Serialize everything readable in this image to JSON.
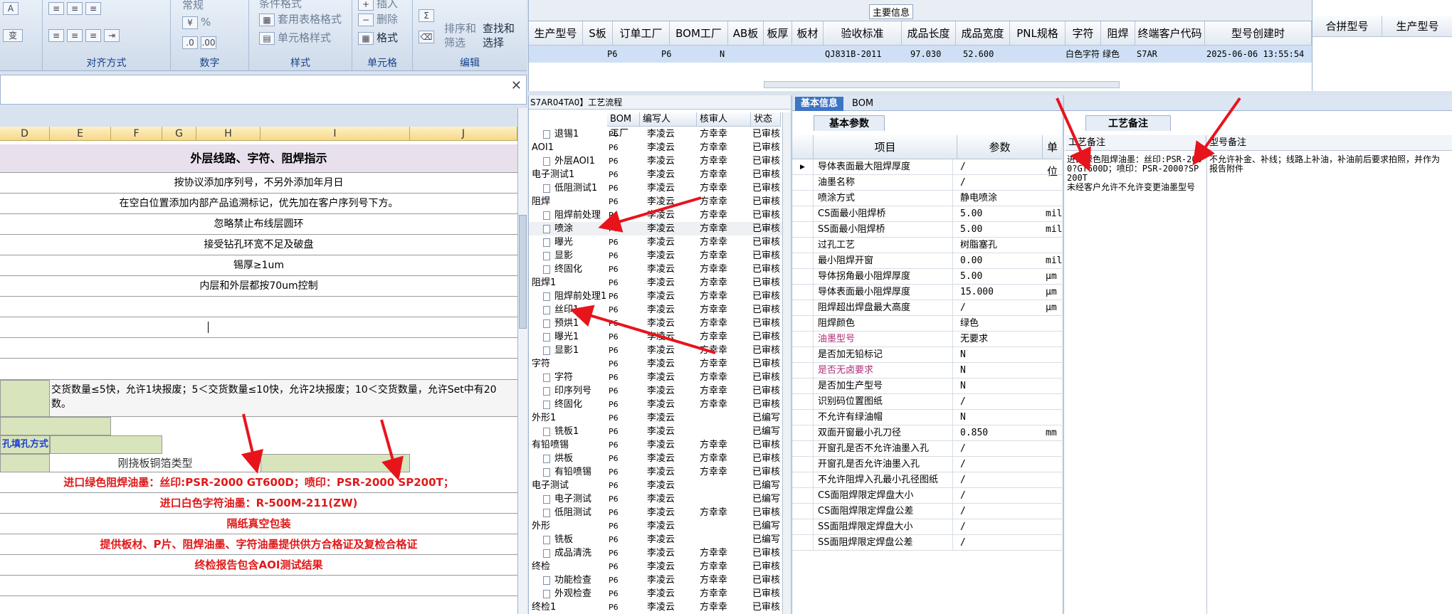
{
  "ribbon": {
    "groups": [
      {
        "label": "对齐方式"
      },
      {
        "label": "数字"
      },
      {
        "label": "样式"
      },
      {
        "label": "单元格"
      },
      {
        "label": "编辑"
      }
    ],
    "font_icons": {
      "a_up": "A",
      "a_down": "A",
      "change": "变"
    },
    "number_format": "常规",
    "percent": "%",
    "table_format": "套用表格格式",
    "cell_style": "单元格样式",
    "insert": "插入",
    "delete": "删除",
    "format": "格式",
    "sort_filter": "排序和\n筛选",
    "find_select": "查找和\n选择",
    "cond_format": "条件格式",
    "sum_icon": "Σ"
  },
  "sheet": {
    "columns": [
      "D",
      "E",
      "F",
      "G",
      "H",
      "I",
      "J"
    ],
    "title": "外层线路、字符、阻焊指示",
    "rows": [
      "按协议添加序列号，不另外添加年月日",
      "在空白位置添加内部产品追溯标记，优先加在客户序列号下方。",
      "忽略禁止布线层圆环",
      "接受钻孔环宽不足及破盘",
      "锡厚≥1um",
      "内层和外层都按70um控制"
    ],
    "delivery_note": "交货数量≤5快，允许1块报废；5＜交货数量≤10快，允许2块报废；10＜交货数量，允许Set中有20",
    "delivery_note2": "数。",
    "fill_method": "孔填孔方式",
    "copper_type": "刚挠板铜箔类型",
    "red_lines": [
      "进口绿色阻焊油墨：丝印:PSR-2000 GT600D；喷印：PSR-2000 SP200T；",
      "进口白色字符油墨：R-500M-211(ZW)",
      "隔纸真空包装",
      "提供板材、P片、阻焊油墨、字符油墨提供供方合格证及复检合格证",
      "终检报告包含AOI测试结果"
    ]
  },
  "main_grid": {
    "group_title": "主要信息",
    "headers": [
      "生产型号",
      "S板",
      "订单工厂",
      "BOM工厂",
      "AB板",
      "板厚",
      "板材",
      "验收标准",
      "成品长度",
      "成品宽度",
      "PNL规格",
      "字符",
      "阻焊",
      "终端客户代码",
      "型号创建时"
    ],
    "values": [
      "",
      "P6",
      "P6",
      "N",
      "",
      "",
      "",
      "QJ831B-2011",
      "97.030",
      "52.600",
      "",
      "白色字符",
      "绿色",
      "S7AR",
      "2025-06-06 13:55:54"
    ],
    "right_headers": [
      "合拼型号",
      "生产型号"
    ]
  },
  "tree": {
    "title": "S7AR04TA0】工艺流程",
    "headers": [
      "BOM工厂",
      "编写人",
      "核审人",
      "状态"
    ],
    "rows": [
      {
        "indent": 1,
        "name": "退锡1",
        "bom": "P6",
        "writer": "李凌云",
        "checker": "方幸幸",
        "status": "已审核"
      },
      {
        "indent": 0,
        "name": "AOI1",
        "bom": "P6",
        "writer": "李凌云",
        "checker": "方幸幸",
        "status": "已审核"
      },
      {
        "indent": 1,
        "name": "外层AOI1",
        "bom": "P6",
        "writer": "李凌云",
        "checker": "方幸幸",
        "status": "已审核"
      },
      {
        "indent": 0,
        "name": "电子测试1",
        "bom": "P6",
        "writer": "李凌云",
        "checker": "方幸幸",
        "status": "已审核"
      },
      {
        "indent": 1,
        "name": "低阻测试1",
        "bom": "P6",
        "writer": "李凌云",
        "checker": "方幸幸",
        "status": "已审核"
      },
      {
        "indent": 0,
        "name": "阻焊",
        "bom": "P6",
        "writer": "李凌云",
        "checker": "方幸幸",
        "status": "已审核"
      },
      {
        "indent": 1,
        "name": "阻焊前处理",
        "bom": "P6",
        "writer": "李凌云",
        "checker": "方幸幸",
        "status": "已审核"
      },
      {
        "indent": 1,
        "name": "喷涂",
        "bom": "P6",
        "writer": "李凌云",
        "checker": "方幸幸",
        "status": "已审核"
      },
      {
        "indent": 1,
        "name": "曝光",
        "bom": "P6",
        "writer": "李凌云",
        "checker": "方幸幸",
        "status": "已审核"
      },
      {
        "indent": 1,
        "name": "显影",
        "bom": "P6",
        "writer": "李凌云",
        "checker": "方幸幸",
        "status": "已审核"
      },
      {
        "indent": 1,
        "name": "终固化",
        "bom": "P6",
        "writer": "李凌云",
        "checker": "方幸幸",
        "status": "已审核"
      },
      {
        "indent": 0,
        "name": "阻焊1",
        "bom": "P6",
        "writer": "李凌云",
        "checker": "方幸幸",
        "status": "已审核"
      },
      {
        "indent": 1,
        "name": "阻焊前处理1",
        "bom": "P6",
        "writer": "李凌云",
        "checker": "方幸幸",
        "status": "已审核"
      },
      {
        "indent": 1,
        "name": "丝印1",
        "bom": "P6",
        "writer": "李凌云",
        "checker": "方幸幸",
        "status": "已审核"
      },
      {
        "indent": 1,
        "name": "预烘1",
        "bom": "P6",
        "writer": "李凌云",
        "checker": "方幸幸",
        "status": "已审核"
      },
      {
        "indent": 1,
        "name": "曝光1",
        "bom": "P6",
        "writer": "李凌云",
        "checker": "方幸幸",
        "status": "已审核"
      },
      {
        "indent": 1,
        "name": "显影1",
        "bom": "P6",
        "writer": "李凌云",
        "checker": "方幸幸",
        "status": "已审核"
      },
      {
        "indent": 0,
        "name": "字符",
        "bom": "P6",
        "writer": "李凌云",
        "checker": "方幸幸",
        "status": "已审核"
      },
      {
        "indent": 1,
        "name": "字符",
        "bom": "P6",
        "writer": "李凌云",
        "checker": "方幸幸",
        "status": "已审核"
      },
      {
        "indent": 1,
        "name": "印序列号",
        "bom": "P6",
        "writer": "李凌云",
        "checker": "方幸幸",
        "status": "已审核"
      },
      {
        "indent": 1,
        "name": "终固化",
        "bom": "P6",
        "writer": "李凌云",
        "checker": "方幸幸",
        "status": "已审核"
      },
      {
        "indent": 0,
        "name": "外形1",
        "bom": "P6",
        "writer": "李凌云",
        "checker": "",
        "status": "已编写"
      },
      {
        "indent": 1,
        "name": "铣板1",
        "bom": "P6",
        "writer": "李凌云",
        "checker": "",
        "status": "已编写"
      },
      {
        "indent": 0,
        "name": "有铅喷锡",
        "bom": "P6",
        "writer": "李凌云",
        "checker": "方幸幸",
        "status": "已审核"
      },
      {
        "indent": 1,
        "name": "烘板",
        "bom": "P6",
        "writer": "李凌云",
        "checker": "方幸幸",
        "status": "已审核"
      },
      {
        "indent": 1,
        "name": "有铅喷锡",
        "bom": "P6",
        "writer": "李凌云",
        "checker": "方幸幸",
        "status": "已审核"
      },
      {
        "indent": 0,
        "name": "电子测试",
        "bom": "P6",
        "writer": "李凌云",
        "checker": "",
        "status": "已编写"
      },
      {
        "indent": 1,
        "name": "电子测试",
        "bom": "P6",
        "writer": "李凌云",
        "checker": "",
        "status": "已编写"
      },
      {
        "indent": 1,
        "name": "低阻测试",
        "bom": "P6",
        "writer": "李凌云",
        "checker": "方幸幸",
        "status": "已审核"
      },
      {
        "indent": 0,
        "name": "外形",
        "bom": "P6",
        "writer": "李凌云",
        "checker": "",
        "status": "已编写"
      },
      {
        "indent": 1,
        "name": "铣板",
        "bom": "P6",
        "writer": "李凌云",
        "checker": "",
        "status": "已编写"
      },
      {
        "indent": 1,
        "name": "成品清洗",
        "bom": "P6",
        "writer": "李凌云",
        "checker": "方幸幸",
        "status": "已审核"
      },
      {
        "indent": 0,
        "name": "终检",
        "bom": "P6",
        "writer": "李凌云",
        "checker": "方幸幸",
        "status": "已审核"
      },
      {
        "indent": 1,
        "name": "功能检查",
        "bom": "P6",
        "writer": "李凌云",
        "checker": "方幸幸",
        "status": "已审核"
      },
      {
        "indent": 1,
        "name": "外观检查",
        "bom": "P6",
        "writer": "李凌云",
        "checker": "方幸幸",
        "status": "已审核"
      },
      {
        "indent": 0,
        "name": "终检1",
        "bom": "P6",
        "writer": "李凌云",
        "checker": "方幸幸",
        "status": "已审核"
      }
    ]
  },
  "basic": {
    "tabs": [
      "基本信息",
      "BOM"
    ],
    "subtab": "基本参数",
    "headers": [
      "项目",
      "参数",
      "单位"
    ],
    "rows": [
      {
        "item": "导体表面最大阻焊厚度",
        "value": "/",
        "unit": "",
        "pink": false
      },
      {
        "item": "油墨名称",
        "value": "/",
        "unit": "",
        "pink": false
      },
      {
        "item": "喷涂方式",
        "value": "静电喷涂",
        "unit": "",
        "pink": false
      },
      {
        "item": "CS面最小阻焊桥",
        "value": "5.00",
        "unit": "mil",
        "pink": false
      },
      {
        "item": "SS面最小阻焊桥",
        "value": "5.00",
        "unit": "mil",
        "pink": false
      },
      {
        "item": "过孔工艺",
        "value": "树脂塞孔",
        "unit": "",
        "pink": false
      },
      {
        "item": "最小阻焊开窗",
        "value": "0.00",
        "unit": "mil",
        "pink": false
      },
      {
        "item": "导体拐角最小阻焊厚度",
        "value": "5.00",
        "unit": "μm",
        "pink": false
      },
      {
        "item": "导体表面最小阻焊厚度",
        "value": "15.000",
        "unit": "μm",
        "pink": false
      },
      {
        "item": "阻焊超出焊盘最大高度",
        "value": "/",
        "unit": "μm",
        "pink": false
      },
      {
        "item": "阻焊颜色",
        "value": "绿色",
        "unit": "",
        "pink": false
      },
      {
        "item": "油墨型号",
        "value": "无要求",
        "unit": "",
        "pink": true
      },
      {
        "item": "是否加无铅标记",
        "value": "N",
        "unit": "",
        "pink": false
      },
      {
        "item": "是否无卤要求",
        "value": "N",
        "unit": "",
        "pink": true
      },
      {
        "item": "是否加生产型号",
        "value": "N",
        "unit": "",
        "pink": false
      },
      {
        "item": "识别码位置图纸",
        "value": "/",
        "unit": "",
        "pink": false
      },
      {
        "item": "不允许有绿油帽",
        "value": "N",
        "unit": "",
        "pink": false
      },
      {
        "item": "双面开窗最小孔刀径",
        "value": "0.850",
        "unit": "mm",
        "pink": false
      },
      {
        "item": "开窗孔是否不允许油墨入孔",
        "value": "/",
        "unit": "",
        "pink": false
      },
      {
        "item": "开窗孔是否允许油墨入孔",
        "value": "/",
        "unit": "",
        "pink": false
      },
      {
        "item": "不允许阻焊入孔最小孔径图纸",
        "value": "/",
        "unit": "",
        "pink": false
      },
      {
        "item": "CS面阻焊限定焊盘大小",
        "value": "/",
        "unit": "",
        "pink": false
      },
      {
        "item": "CS面阻焊限定焊盘公差",
        "value": "/",
        "unit": "",
        "pink": false
      },
      {
        "item": "SS面阻焊限定焊盘大小",
        "value": "/",
        "unit": "",
        "pink": false
      },
      {
        "item": "SS面阻焊限定焊盘公差",
        "value": "/",
        "unit": "",
        "pink": false
      }
    ]
  },
  "notes": {
    "tab": "工艺备注",
    "col1": "工艺备注",
    "col2": "型号备注",
    "text1": "进口绿色阻焊油墨：丝印:PSR-2000?GT600D；喷印：PSR-2000?SP200T\n未经客户允许不允许变更油墨型号",
    "text2": "不允许补金、补线；线路上补油，补油前后要求拍照，并作为报告附件"
  }
}
